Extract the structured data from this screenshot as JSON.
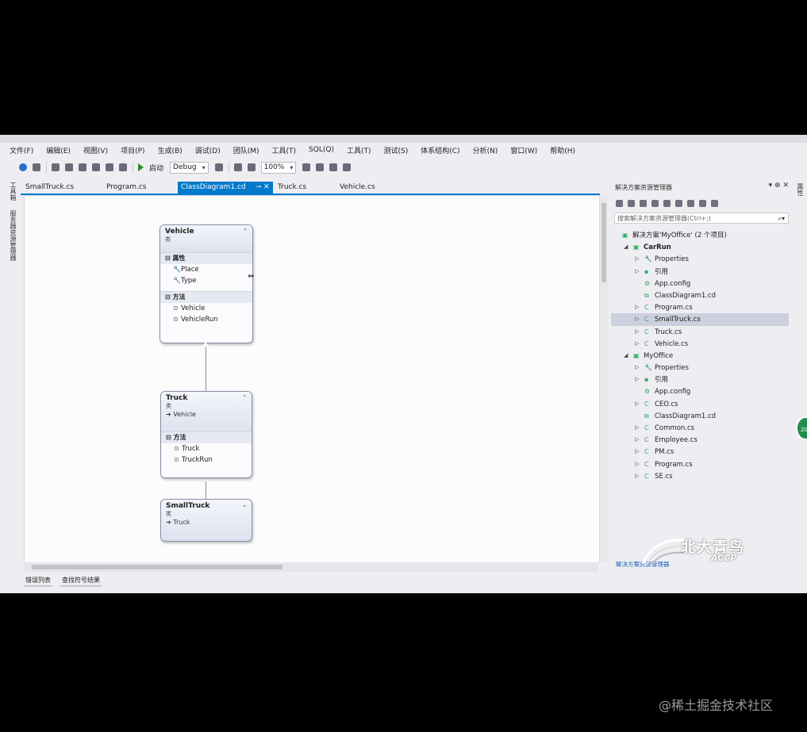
{
  "menu": [
    "文件(F)",
    "编辑(E)",
    "视图(V)",
    "项目(P)",
    "生成(B)",
    "调试(D)",
    "团队(M)",
    "工具(T)",
    "SQL(Q)",
    "工具(T)",
    "测试(S)",
    "体系结构(C)",
    "分析(N)",
    "窗口(W)",
    "帮助(H)"
  ],
  "toolbar": {
    "start_label": "启动",
    "config": "Debug",
    "zoom": "100%"
  },
  "left_strip": {
    "toolbox": "工具箱",
    "other": "服务器资源管理器"
  },
  "doc_tabs": [
    "SmallTruck.cs",
    "Program.cs",
    "ClassDiagram1.cd",
    "Truck.cs",
    "Vehicle.cs"
  ],
  "active_tab_index": 2,
  "diagram": {
    "vehicle": {
      "name": "Vehicle",
      "kind": "类",
      "props_header": "属性",
      "props": [
        "Place",
        "Type"
      ],
      "methods_header": "方法",
      "methods": [
        "Vehicle",
        "VehicleRun"
      ]
    },
    "truck": {
      "name": "Truck",
      "kind": "类",
      "base": "Vehicle",
      "methods_header": "方法",
      "methods": [
        "Truck",
        "TruckRun"
      ]
    },
    "smalltruck": {
      "name": "SmallTruck",
      "kind": "类",
      "base": "Truck"
    }
  },
  "bottom_tabs": [
    "错误列表",
    "查找符号结果"
  ],
  "solution_explorer": {
    "title": "解决方案资源管理器",
    "search_placeholder": "搜索解决方案资源管理器(Ctrl+;)",
    "tree": [
      {
        "label": "解决方案'MyOffice' (2 个项目)",
        "level": 0,
        "icon": "solution-icon",
        "expander": ""
      },
      {
        "label": "CarRun",
        "level": 1,
        "icon": "csproj-icon",
        "expander": "◢",
        "bold": true
      },
      {
        "label": "Properties",
        "level": 2,
        "icon": "wrench-icon",
        "expander": "▷"
      },
      {
        "label": "引用",
        "level": 2,
        "icon": "references-icon",
        "expander": "▷"
      },
      {
        "label": "App.config",
        "level": 2,
        "icon": "config-icon",
        "expander": ""
      },
      {
        "label": "ClassDiagram1.cd",
        "level": 2,
        "icon": "diagram-icon",
        "expander": ""
      },
      {
        "label": "Program.cs",
        "level": 2,
        "icon": "cs-file-icon",
        "expander": "▷"
      },
      {
        "label": "SmallTruck.cs",
        "level": 2,
        "icon": "cs-file-icon",
        "expander": "▷",
        "selected": true
      },
      {
        "label": "Truck.cs",
        "level": 2,
        "icon": "cs-file-icon",
        "expander": "▷"
      },
      {
        "label": "Vehicle.cs",
        "level": 2,
        "icon": "cs-file-icon",
        "expander": "▷"
      },
      {
        "label": "MyOffice",
        "level": 1,
        "icon": "csproj-icon",
        "expander": "◢"
      },
      {
        "label": "Properties",
        "level": 2,
        "icon": "wrench-icon",
        "expander": "▷"
      },
      {
        "label": "引用",
        "level": 2,
        "icon": "references-icon",
        "expander": "▷"
      },
      {
        "label": "App.config",
        "level": 2,
        "icon": "config-icon",
        "expander": ""
      },
      {
        "label": "CEO.cs",
        "level": 2,
        "icon": "cs-file-icon",
        "expander": "▷"
      },
      {
        "label": "ClassDiagram1.cd",
        "level": 2,
        "icon": "diagram-icon",
        "expander": ""
      },
      {
        "label": "Common.cs",
        "level": 2,
        "icon": "cs-file-icon",
        "expander": "▷"
      },
      {
        "label": "Employee.cs",
        "level": 2,
        "icon": "cs-file-icon",
        "expander": "▷"
      },
      {
        "label": "PM.cs",
        "level": 2,
        "icon": "cs-file-icon",
        "expander": "▷"
      },
      {
        "label": "Program.cs",
        "level": 2,
        "icon": "cs-file-icon",
        "expander": "▷"
      },
      {
        "label": "SE.cs",
        "level": 2,
        "icon": "cs-file-icon",
        "expander": "▷"
      }
    ],
    "bottom_tab": "解决方案资源管理器"
  },
  "right_strip": "属性",
  "logo": {
    "cn": "北大青鸟",
    "en": "ACCP"
  },
  "watermark": "@稀土掘金技术社区"
}
